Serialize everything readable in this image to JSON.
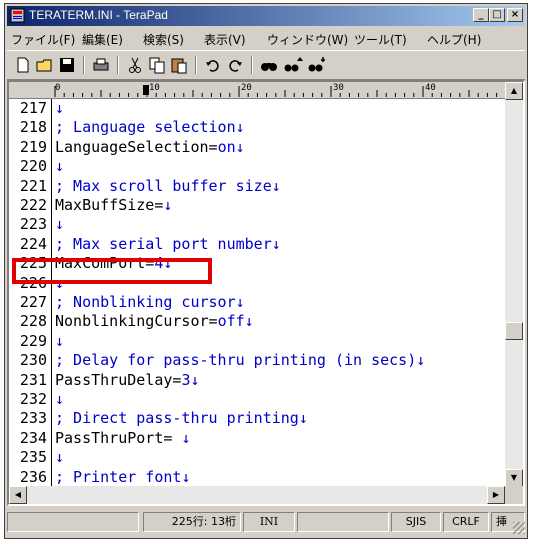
{
  "window": {
    "title": "TERATERM.INI - TeraPad",
    "minimize_label": "_",
    "maximize_label": "□",
    "close_label": "×"
  },
  "menu": [
    "ファイル(F)",
    "編集(E)",
    "検索(S)",
    "表示(V)",
    "ウィンドウ(W)",
    "ツール(T)",
    "ヘルプ(H)"
  ],
  "ruler_marks": [
    "0",
    "10",
    "20",
    "30",
    "40"
  ],
  "lines": [
    {
      "num": "217",
      "text": "",
      "nl": "↓"
    },
    {
      "num": "218",
      "text": "; Language selection",
      "nl": "↓",
      "comment": true
    },
    {
      "num": "219",
      "text": "LanguageSelection=",
      "value": "on",
      "nl": "↓"
    },
    {
      "num": "220",
      "text": "",
      "nl": "↓"
    },
    {
      "num": "221",
      "text": "; Max scroll buffer size",
      "nl": "↓",
      "comment": true
    },
    {
      "num": "222",
      "text": "MaxBuffSize=",
      "value": "",
      "nl": "↓"
    },
    {
      "num": "223",
      "text": "",
      "nl": "↓"
    },
    {
      "num": "224",
      "text": "; Max serial port number",
      "nl": "↓",
      "comment": true
    },
    {
      "num": "225",
      "text": "MaxComPort=",
      "value": "4",
      "nl": "↓"
    },
    {
      "num": "226",
      "text": "",
      "nl": "↓"
    },
    {
      "num": "227",
      "text": "; Nonblinking cursor",
      "nl": "↓",
      "comment": true
    },
    {
      "num": "228",
      "text": "NonblinkingCursor=",
      "value": "off",
      "nl": "↓"
    },
    {
      "num": "229",
      "text": "",
      "nl": "↓"
    },
    {
      "num": "230",
      "text": "; Delay for pass-thru printing (in secs)",
      "nl": "↓",
      "comment": true
    },
    {
      "num": "231",
      "text": "PassThruDelay=",
      "value": "3",
      "nl": "↓"
    },
    {
      "num": "232",
      "text": "",
      "nl": "↓"
    },
    {
      "num": "233",
      "text": "; Direct pass-thru printing",
      "nl": "↓",
      "comment": true
    },
    {
      "num": "234",
      "text": "PassThruPort= ",
      "value": "",
      "nl": "↓"
    },
    {
      "num": "235",
      "text": "",
      "nl": "↓"
    },
    {
      "num": "236",
      "text": "; Printer font",
      "nl": "↓",
      "comment": true
    }
  ],
  "status": {
    "position": "225行: 13桁",
    "mode": "INI",
    "encoding": "SJIS",
    "newline": "CRLF",
    "extra": "挿"
  }
}
